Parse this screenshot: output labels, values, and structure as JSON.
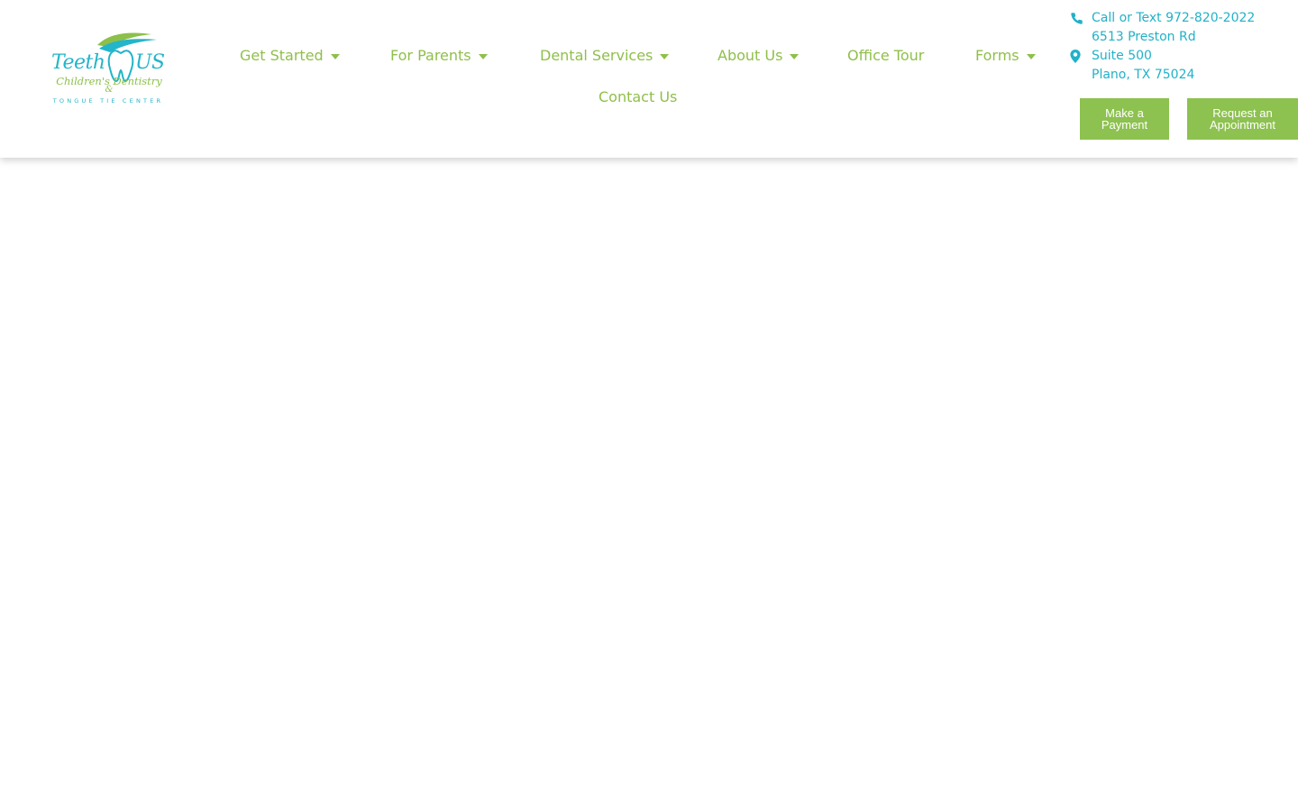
{
  "logo": {
    "word_left": "Teeth",
    "word_right": "US",
    "subtitle": "Children's Dentistry",
    "ampersand": "&",
    "tagline": "TONGUE TIE CENTER",
    "tooth_color": "#23b5c9",
    "swoosh_colors": [
      "#8cc04a",
      "#23b5c9"
    ]
  },
  "nav": {
    "items": [
      {
        "label": "Get Started",
        "has_dropdown": true
      },
      {
        "label": "For Parents",
        "has_dropdown": true
      },
      {
        "label": "Dental Services",
        "has_dropdown": true
      },
      {
        "label": "About Us",
        "has_dropdown": true
      },
      {
        "label": "Office Tour",
        "has_dropdown": false
      },
      {
        "label": "Forms",
        "has_dropdown": true
      },
      {
        "label": "Contact Us",
        "has_dropdown": false
      }
    ],
    "color": "#8fbf4a"
  },
  "contact": {
    "phone": "Call or Text 972-820-2022",
    "address_line1": "6513 Preston Rd",
    "address_line2": "Suite 500",
    "address_line3": "Plano, TX 75024",
    "color": "#22b1c8",
    "phone_icon": "phone-icon",
    "address_icon": "map-pin-icon"
  },
  "buttons": {
    "payment_line1": "Make a",
    "payment_line2": "Payment",
    "appointment_line1": "Request an",
    "appointment_line2": "Appointment",
    "color": "#8dc150"
  }
}
